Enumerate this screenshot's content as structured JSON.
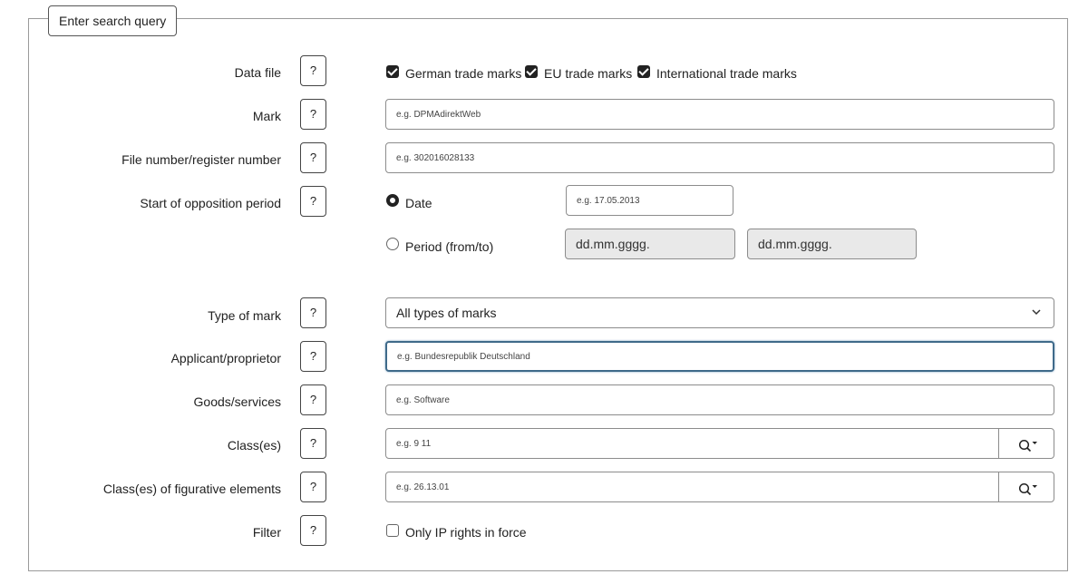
{
  "legend": "Enter search query",
  "help_label": "?",
  "data_file": {
    "label": "Data file",
    "options": [
      {
        "label": "German trade marks",
        "checked": true
      },
      {
        "label": "EU trade marks",
        "checked": true
      },
      {
        "label": "International trade marks",
        "checked": true
      }
    ]
  },
  "mark": {
    "label": "Mark",
    "placeholder": "e.g. DPMAdirektWeb"
  },
  "file_number": {
    "label": "File number/register number",
    "placeholder": "e.g. 302016028133"
  },
  "opposition": {
    "label": "Start of opposition period",
    "date_option": "Date",
    "date_placeholder": "e.g. 17.05.2013",
    "period_option": "Period (from/to)",
    "from_placeholder": "dd.mm.gggg.",
    "to_placeholder": "dd.mm.gggg."
  },
  "type_of_mark": {
    "label": "Type of mark",
    "selected": "All types of marks"
  },
  "applicant": {
    "label": "Applicant/proprietor",
    "placeholder": "e.g. Bundesrepublik Deutschland"
  },
  "goods": {
    "label": "Goods/services",
    "placeholder": "e.g. Software"
  },
  "classes": {
    "label": "Class(es)",
    "placeholder": "e.g. 9 11"
  },
  "figurative": {
    "label": "Class(es) of figurative elements",
    "placeholder": "e.g. 26.13.01"
  },
  "filter": {
    "label": "Filter",
    "option": "Only IP rights in force",
    "checked": false
  }
}
